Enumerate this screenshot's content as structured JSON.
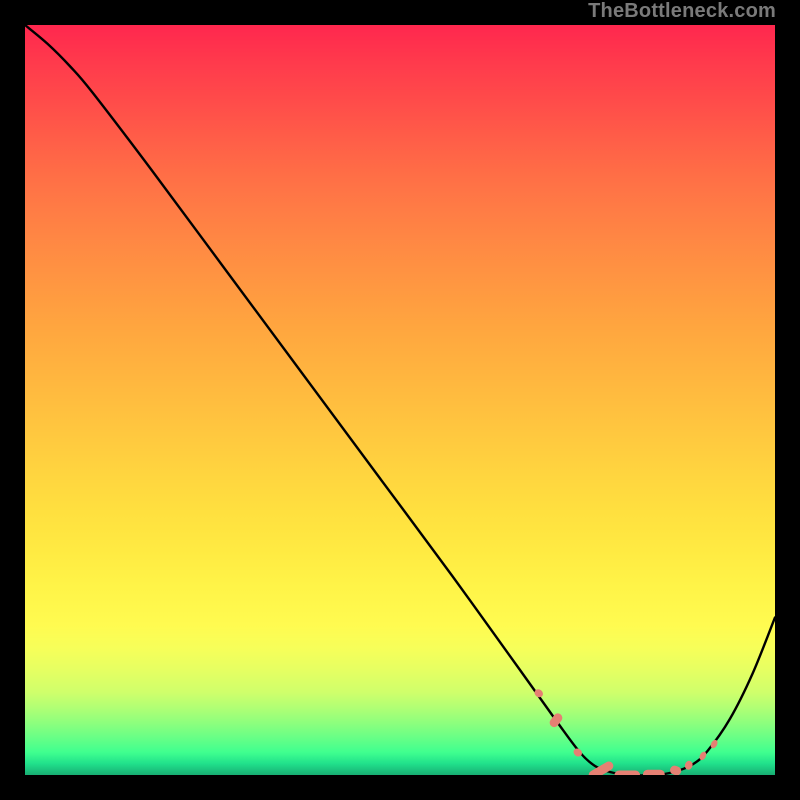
{
  "watermark": "TheBottleneck.com",
  "chart_data": {
    "type": "line",
    "title": "",
    "xlabel": "",
    "ylabel": "",
    "xlim": [
      0,
      100
    ],
    "ylim": [
      0,
      100
    ],
    "background": "rainbow-gradient",
    "series": [
      {
        "name": "curve",
        "stroke": "#000000",
        "points": [
          {
            "x": 0.0,
            "y": 100.0
          },
          {
            "x": 3.0,
            "y": 97.5
          },
          {
            "x": 6.0,
            "y": 94.5
          },
          {
            "x": 9.0,
            "y": 91.0
          },
          {
            "x": 17.0,
            "y": 80.5
          },
          {
            "x": 27.0,
            "y": 67.0
          },
          {
            "x": 37.0,
            "y": 53.5
          },
          {
            "x": 47.0,
            "y": 40.0
          },
          {
            "x": 57.0,
            "y": 26.5
          },
          {
            "x": 66.0,
            "y": 14.0
          },
          {
            "x": 71.0,
            "y": 7.0
          },
          {
            "x": 74.0,
            "y": 3.0
          },
          {
            "x": 76.0,
            "y": 1.2
          },
          {
            "x": 78.0,
            "y": 0.4
          },
          {
            "x": 80.5,
            "y": 0.0
          },
          {
            "x": 84.0,
            "y": 0.0
          },
          {
            "x": 86.5,
            "y": 0.4
          },
          {
            "x": 89.0,
            "y": 1.4
          },
          {
            "x": 91.0,
            "y": 3.2
          },
          {
            "x": 94.0,
            "y": 7.5
          },
          {
            "x": 97.0,
            "y": 13.5
          },
          {
            "x": 100.0,
            "y": 21.0
          }
        ]
      },
      {
        "name": "bottom-markers",
        "stroke": "#e58073",
        "fill": "#e58073",
        "type": "scatter",
        "segments": [
          {
            "x0": 68.0,
            "x1": 69.0,
            "y": 10.9
          },
          {
            "x0": 69.8,
            "x1": 71.8,
            "y": 7.3
          },
          {
            "x0": 73.2,
            "x1": 74.2,
            "y": 3.0
          },
          {
            "x0": 75.0,
            "x1": 78.6,
            "y": 0.6
          },
          {
            "x0": 78.6,
            "x1": 82.0,
            "y": 0.0
          },
          {
            "x0": 82.4,
            "x1": 85.3,
            "y": 0.1
          },
          {
            "x0": 86.0,
            "x1": 87.5,
            "y": 0.6
          },
          {
            "x0": 88.0,
            "x1": 89.0,
            "y": 1.3
          },
          {
            "x0": 90.0,
            "x1": 90.6,
            "y": 2.6
          },
          {
            "x0": 91.5,
            "x1": 92.0,
            "y": 4.2
          }
        ]
      }
    ]
  }
}
